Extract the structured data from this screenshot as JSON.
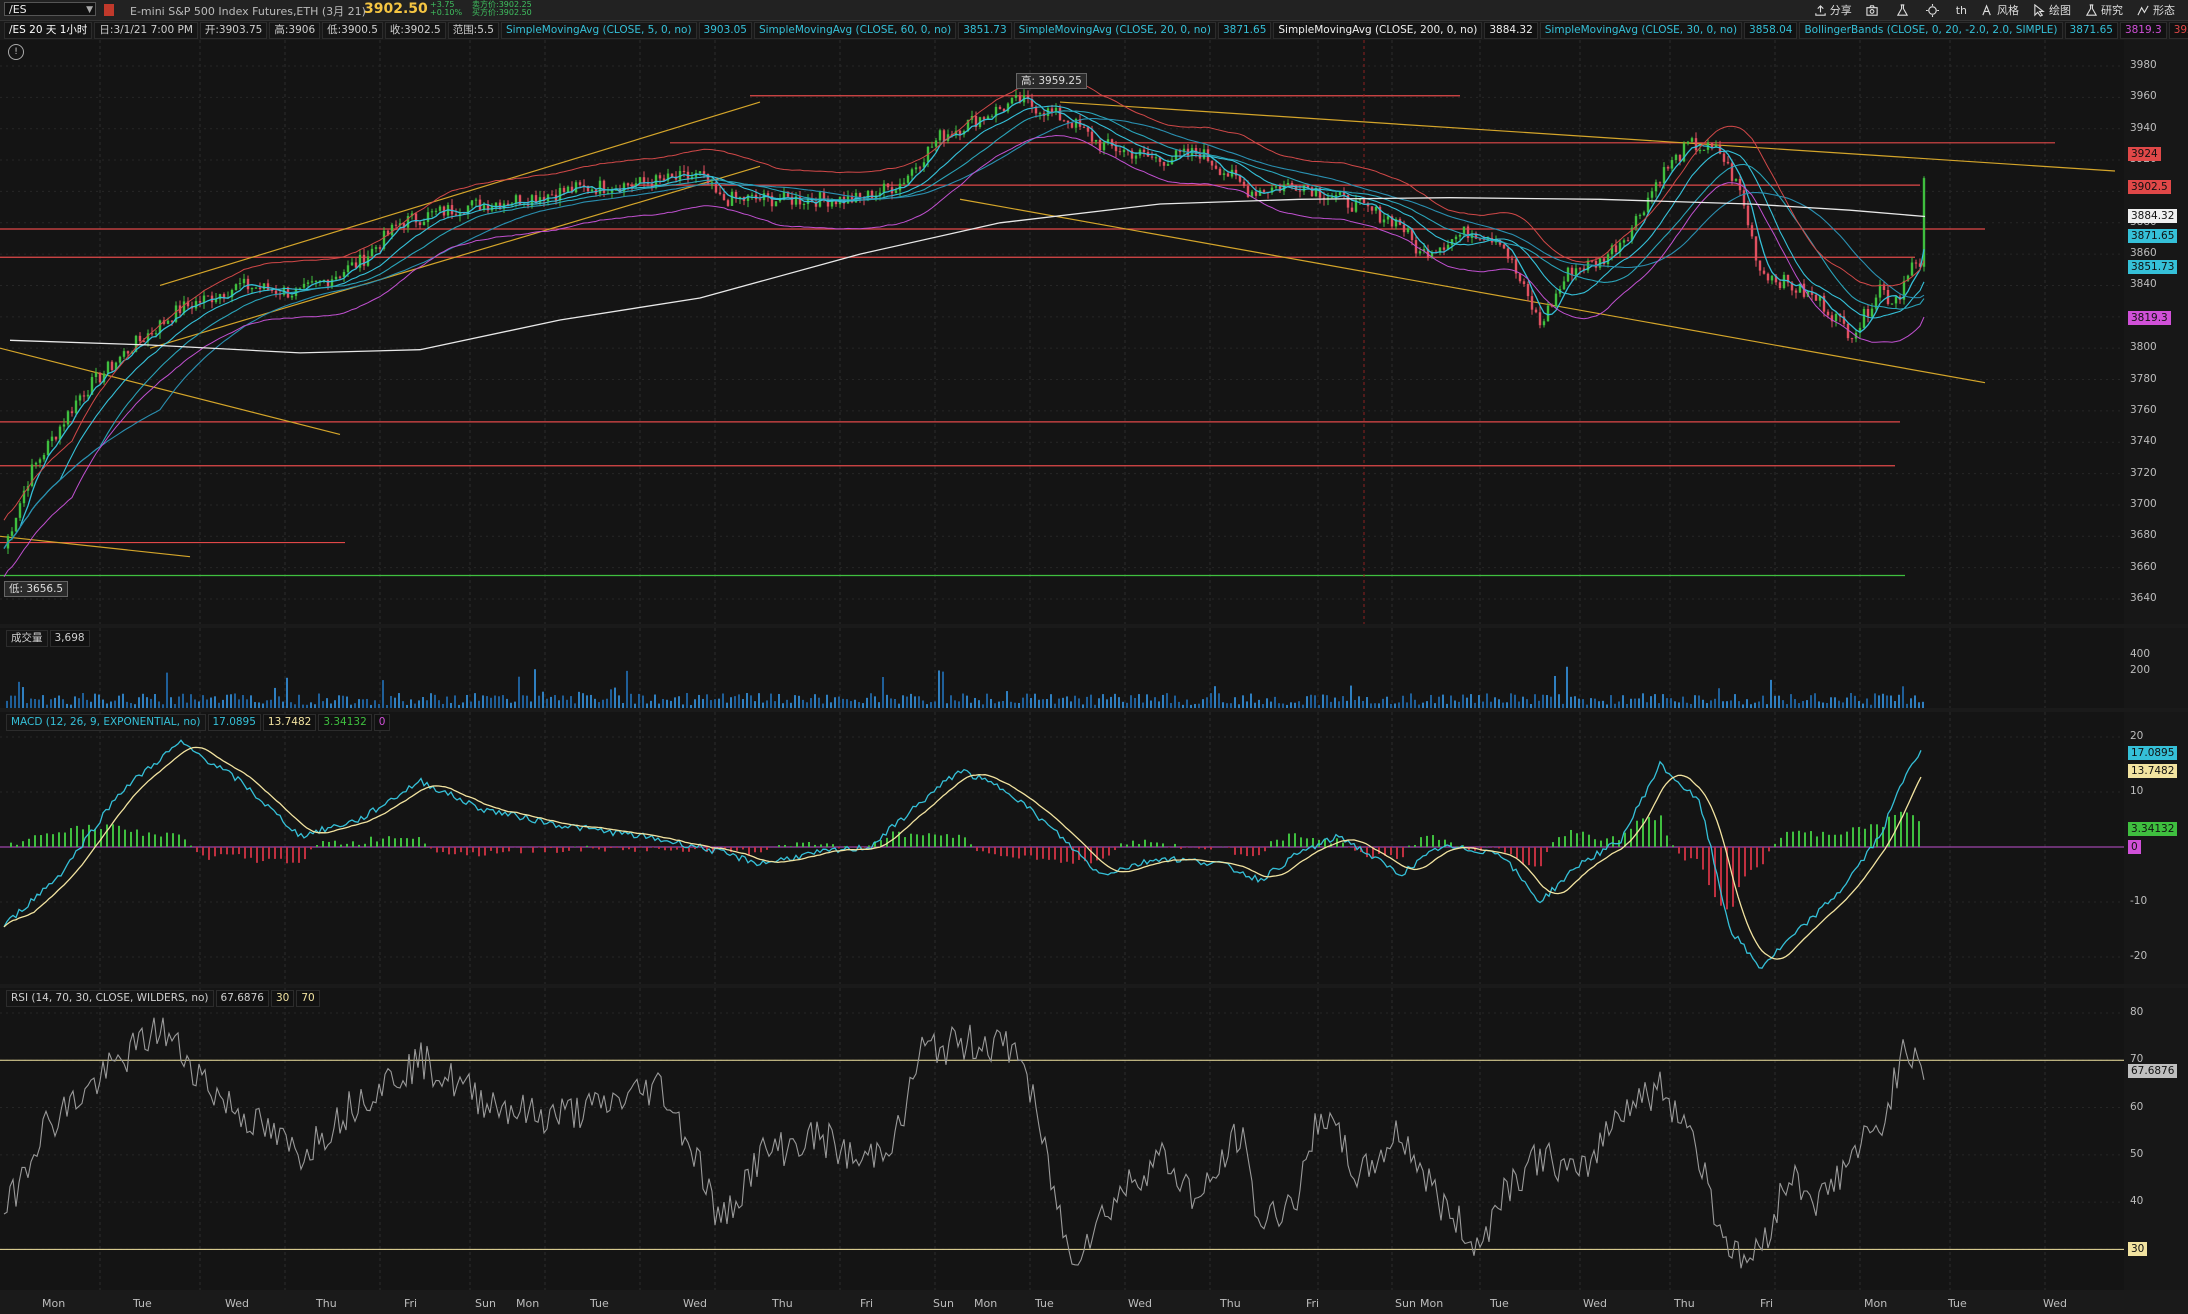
{
  "header": {
    "symbol": "/ES",
    "description": "E-mini S&P 500 Index Futures,ETH (3月 21)",
    "last_price": "3902.50",
    "change": "+3.75",
    "change_pct": "+0.10%",
    "bid": "卖方价:3902.25",
    "ask": "买方价:3902.50",
    "tools": [
      {
        "icon": "share-icon",
        "label": "分享"
      },
      {
        "icon": "camera-icon",
        "label": ""
      },
      {
        "icon": "flask-icon",
        "label": ""
      },
      {
        "icon": "gear-icon",
        "label": ""
      },
      {
        "icon": "th-icon",
        "label": "th"
      },
      {
        "icon": "style-icon",
        "label": "风格"
      },
      {
        "icon": "cursor-icon",
        "label": "绘图"
      },
      {
        "icon": "flask-icon",
        "label": "研究"
      },
      {
        "icon": "pattern-icon",
        "label": "形态"
      }
    ]
  },
  "studies": {
    "period": "/ES 20 天 1小时",
    "date": "日:3/1/21 7:00 PM",
    "open": "开:3903.75",
    "high": "高:3906",
    "low": "低:3900.5",
    "close": "收:3902.5",
    "range": "范围:5.5",
    "sma5_label": "SimpleMovingAvg (CLOSE, 5, 0, no)",
    "sma5_value": "3903.05",
    "sma60_label": "SimpleMovingAvg (CLOSE, 60, 0, no)",
    "sma60_value": "3851.73",
    "sma20_label": "SimpleMovingAvg (CLOSE, 20, 0, no)",
    "sma20_value": "3871.65",
    "sma200_label": "SimpleMovingAvg (CLOSE, 200, 0, no)",
    "sma200_value": "3884.32",
    "sma30_label": "SimpleMovingAvg (CLOSE, 30, 0, no)",
    "sma30_value": "3858.04",
    "bb_label": "BollingerBands (CLOSE, 0, 20, -2.0, 2.0, SIMPLE)",
    "bb_mid": "3871.65",
    "bb_low": "3819.3",
    "bb_up": "3924"
  },
  "price_pane": {
    "y_ticks": [
      "3980",
      "3960",
      "3940",
      "3920",
      "3900",
      "3880",
      "3860",
      "3840",
      "3820",
      "3800",
      "3780",
      "3760",
      "3740",
      "3720",
      "3700",
      "3680",
      "3660",
      "3640"
    ],
    "tags": [
      {
        "text": "3924",
        "color": "#e04848"
      },
      {
        "text": "3902.5",
        "color": "#e04848"
      },
      {
        "text": "3884.32",
        "color": "#f0f0f0"
      },
      {
        "text": "3871.65",
        "color": "#35c0d8"
      },
      {
        "text": "3851.73",
        "color": "#35c0d8"
      },
      {
        "text": "3819.3",
        "color": "#d050d8"
      }
    ],
    "high_label": "高: 3959.25",
    "low_label": "低: 3656.5"
  },
  "volume_pane": {
    "label": "成交量",
    "value": "3,698",
    "y_ticks": [
      "400",
      "200"
    ]
  },
  "macd_pane": {
    "label": "MACD (12, 26, 9, EXPONENTIAL, no)",
    "value": "17.0895",
    "avg": "13.7482",
    "diff": "3.34132",
    "zero": "0",
    "y_ticks": [
      "20",
      "10",
      "0",
      "-10",
      "-20"
    ],
    "tags": [
      {
        "text": "17.0895",
        "color": "#35c0d8"
      },
      {
        "text": "13.7482",
        "color": "#f2e3a0"
      },
      {
        "text": "3.34132",
        "color": "#3fbf3f"
      },
      {
        "text": "0",
        "color": "#d050d8"
      }
    ]
  },
  "rsi_pane": {
    "label": "RSI (14, 70, 30, CLOSE, WILDERS, no)",
    "value": "67.6876",
    "oversold": "30",
    "overbought": "70",
    "y_ticks": [
      "80",
      "70",
      "60",
      "50",
      "40",
      "30"
    ],
    "tags": [
      {
        "text": "67.6876",
        "color": "#bfbfbf"
      },
      {
        "text": "30",
        "color": "#f2e3a0"
      }
    ]
  },
  "x_axis": [
    "Mon",
    "Tue",
    "Wed",
    "Thu",
    "Fri",
    "Sun",
    "Mon",
    "Tue",
    "Wed",
    "Thu",
    "Fri",
    "Sun",
    "Mon",
    "Tue",
    "Wed",
    "Thu",
    "Fri",
    "Sun",
    "Mon",
    "Tue",
    "Wed",
    "Thu",
    "Fri",
    "Mon",
    "Tue",
    "Wed"
  ]
}
